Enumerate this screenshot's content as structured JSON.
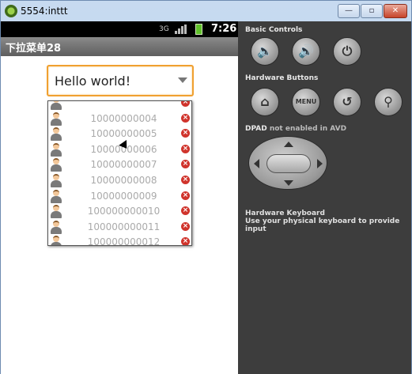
{
  "window": {
    "title": "5554:inttt",
    "min_glyph": "—",
    "max_glyph": "▫",
    "close_glyph": "✕"
  },
  "statusbar": {
    "network": "3G",
    "time": "7:26"
  },
  "app": {
    "title": "下拉菜单28"
  },
  "spinner": {
    "selected": "Hello world!"
  },
  "dropdown": {
    "items": [
      {
        "number": "",
        "partial": true
      },
      {
        "number": "10000000004"
      },
      {
        "number": "10000000005"
      },
      {
        "number": "10000000006"
      },
      {
        "number": "10000000007"
      },
      {
        "number": "10000000008"
      },
      {
        "number": "10000000009"
      },
      {
        "number": "100000000010"
      },
      {
        "number": "100000000011"
      },
      {
        "number": "100000000012",
        "partial": true
      }
    ]
  },
  "panel": {
    "basic_controls": "Basic Controls",
    "hardware_buttons": "Hardware Buttons",
    "dpad_label": "DPAD",
    "dpad_note": "not enabled in AVD",
    "keyboard_title": "Hardware Keyboard",
    "keyboard_hint": "Use your physical keyboard to provide input",
    "menu_label": "MENU"
  },
  "icons": {
    "volume_down": "volume-down-icon",
    "volume_up": "volume-up-icon",
    "power": "power-icon",
    "home": "home-icon",
    "back": "back-icon",
    "search": "search-icon"
  },
  "colors": {
    "spinner_focus": "#f0a030",
    "delete_icon": "#d0342c",
    "battery": "#5fc02a"
  }
}
